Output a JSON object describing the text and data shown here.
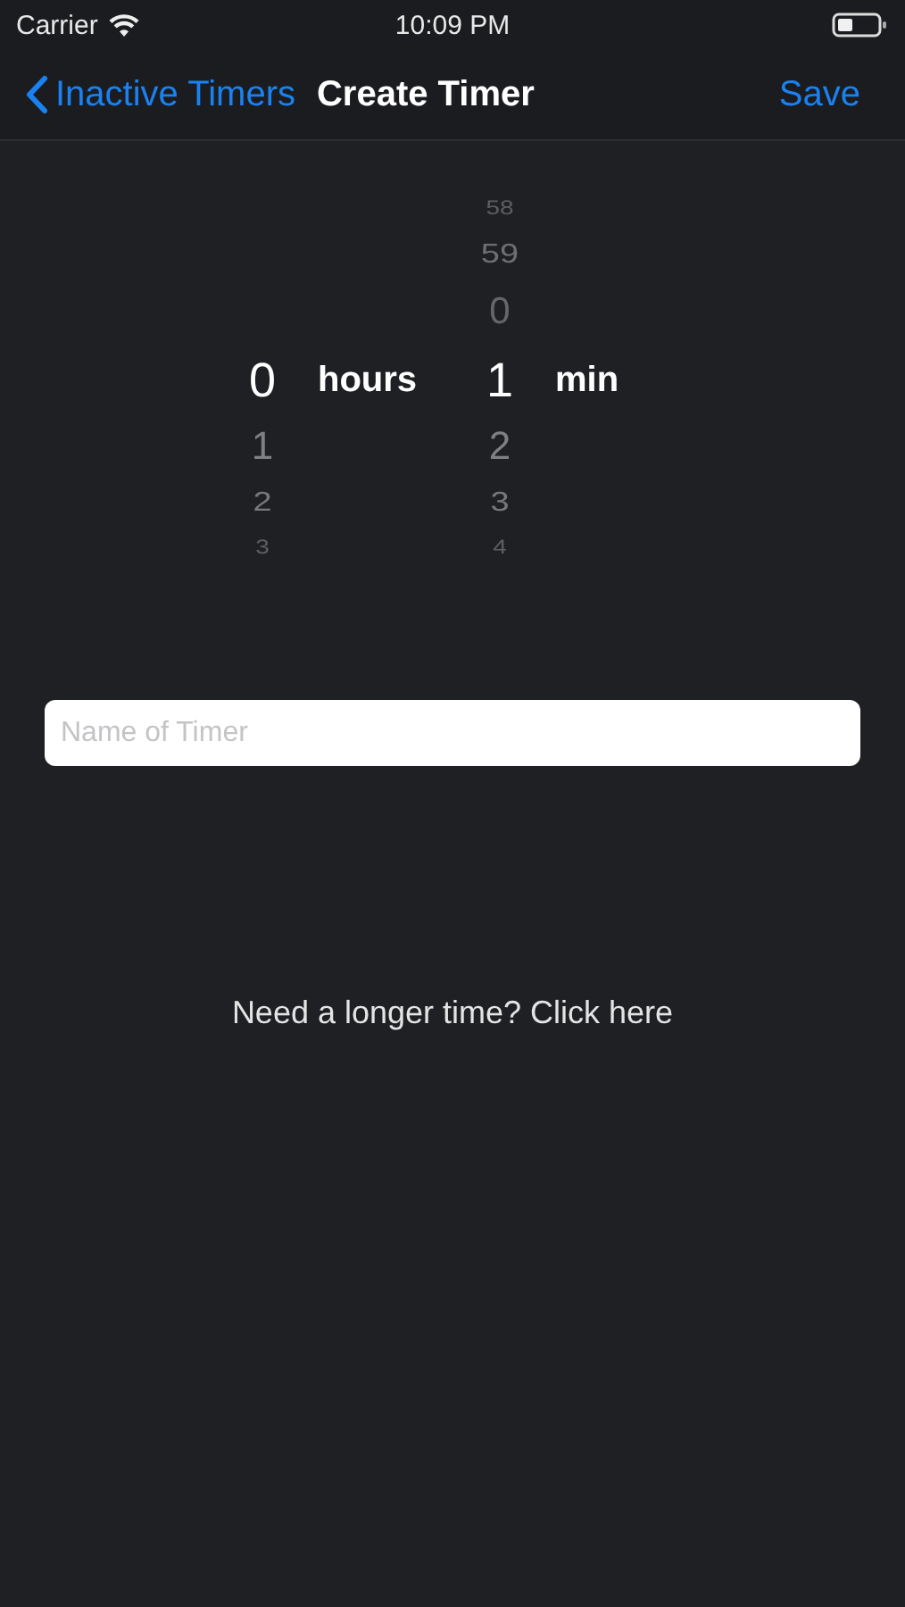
{
  "status_bar": {
    "carrier": "Carrier",
    "time": "10:09 PM"
  },
  "nav_bar": {
    "back": "Inactive Timers",
    "title": "Create Timer",
    "action": "Save"
  },
  "picker": {
    "columns": [
      {
        "unit": "hours",
        "items": [
          {
            "value": "0",
            "selected": true
          },
          {
            "value": "1",
            "selected": false
          },
          {
            "value": "2",
            "selected": false
          },
          {
            "value": "3",
            "selected": false
          }
        ]
      },
      {
        "unit": "min",
        "items": [
          {
            "value": "58",
            "selected": false
          },
          {
            "value": "59",
            "selected": false
          },
          {
            "value": "0",
            "selected": false
          },
          {
            "value": "1",
            "selected": true
          },
          {
            "value": "2",
            "selected": false
          },
          {
            "value": "3",
            "selected": false
          },
          {
            "value": "4",
            "selected": false
          }
        ]
      }
    ]
  },
  "name_field": {
    "placeholder": "Name of Timer"
  },
  "longer_time_link": "Need a longer time? Click here"
}
